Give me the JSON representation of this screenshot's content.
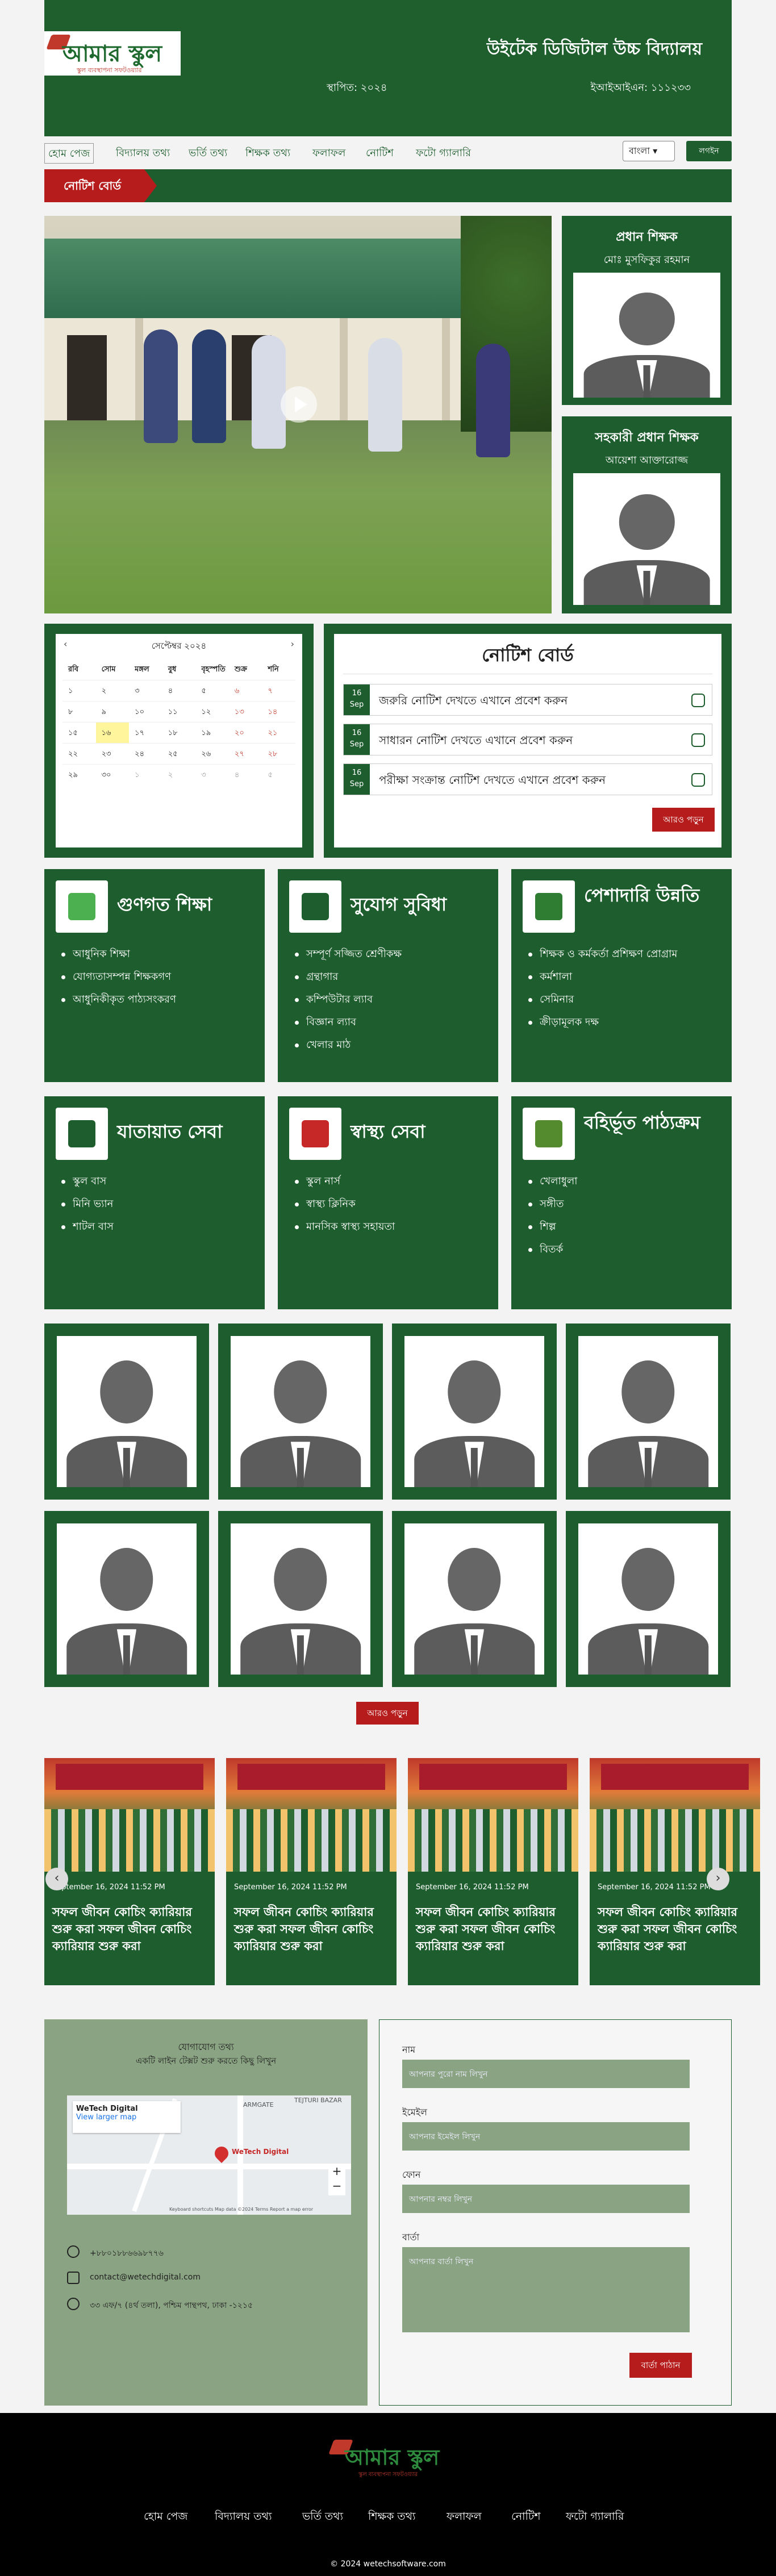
{
  "header": {
    "logo_text": "আমার স্কুল",
    "logo_sub": "স্কুল ব্যবস্থাপনা সফটওয়্যার",
    "school_name": "উইটেক ডিজিটাল উচ্চ বিদ্যালয়",
    "established": "স্থাপিত: ২০২৪",
    "eiin": "ইআইআইএন: ১১১২৩৩"
  },
  "nav": {
    "items": [
      "হোম পেজ",
      "বিদ্যালয় তথ্য",
      "ভর্তি তথ্য",
      "শিক্ষক তথ্য",
      "ফলাফল",
      "নোটিশ",
      "ফটো গ্যালারি"
    ],
    "language": "বাংলা",
    "login": "লগইন"
  },
  "notice_tag": "নোটিশ বোর্ড",
  "principal": {
    "title": "প্রধান শিক্ষক",
    "name": "মোঃ মুসফিকুর রহমান"
  },
  "assistant": {
    "title": "সহকারী প্রধান শিক্ষক",
    "name": "আয়েশা আক্তারোজ্জ"
  },
  "calendar": {
    "title": "সেপ্টেম্বর ২০২৪",
    "prev": "‹",
    "next": "›",
    "days": [
      "রবি",
      "সোম",
      "মঙ্গল",
      "বুধ",
      "বৃহস্পতি",
      "শুক্র",
      "শনি"
    ],
    "weeks": [
      [
        "১",
        "২",
        "৩",
        "৪",
        "৫",
        "৬",
        "৭"
      ],
      [
        "৮",
        "৯",
        "১০",
        "১১",
        "১২",
        "১৩",
        "১৪"
      ],
      [
        "১৫",
        "১৬",
        "১৭",
        "১৮",
        "১৯",
        "২০",
        "২১"
      ],
      [
        "২২",
        "২৩",
        "২৪",
        "২৫",
        "২৬",
        "২৭",
        "২৮"
      ],
      [
        "২৯",
        "৩০",
        "১",
        "২",
        "৩",
        "৪",
        "৫"
      ]
    ],
    "today": "১৬",
    "weekend_color": "#c0392b",
    "today_color": "#fff59d"
  },
  "notice_board": {
    "title": "নোটিশ বোর্ড",
    "items": [
      {
        "day": "16",
        "month": "Sep",
        "text": "জরুরি নোটিশ দেখতে এখানে প্রবেশ করুন"
      },
      {
        "day": "16",
        "month": "Sep",
        "text": "সাধারন নোটিশ দেখতে এখানে প্রবেশ করুন"
      },
      {
        "day": "16",
        "month": "Sep",
        "text": "পরীক্ষা সংক্রান্ত নোটিশ দেখতে এখানে প্রবেশ করুন"
      }
    ],
    "more": "আরও পড়ুন"
  },
  "features": [
    {
      "title": "গুণগত শিক্ষা",
      "icon": "book-icon",
      "items": [
        "আধুনিক শিক্ষা",
        "যোগ্যতাসম্পন্ন শিক্ষকগণ",
        "আধুনিকীকৃত পাঠ্যসংকরণ"
      ]
    },
    {
      "title": "সুযোগ সুবিধা",
      "icon": "school-building-icon",
      "items": [
        "সম্পূর্ণ সজ্জিত শ্রেণীকক্ষ",
        "গ্রন্থাগার",
        "কম্পিউটার ল্যাব",
        "বিজ্ঞান ল্যাব",
        "খেলার মাঠ"
      ]
    },
    {
      "title": "পেশাদারি উন্নতি",
      "icon": "professional-icon",
      "items": [
        "শিক্ষক ও কর্মকর্তা প্রশিক্ষণ প্রোগ্রাম",
        "কর্মশালা",
        "সেমিনার",
        "ক্রীড়ামূলক দক্ষ"
      ]
    },
    {
      "title": "যাতায়াত সেবা",
      "icon": "bus-icon",
      "items": [
        "স্কুল বাস",
        "মিনি ভ্যান",
        "শাটল বাস"
      ]
    },
    {
      "title": "স্বাস্থ্য সেবা",
      "icon": "health-icon",
      "items": [
        "স্কুল নার্স",
        "স্বাস্থ্য ক্লিনিক",
        "মানসিক স্বাস্থ্য সহায়তা"
      ]
    },
    {
      "title": "বহির্ভূত পাঠ্যক্রম",
      "icon": "activity-icon",
      "items": [
        "খেলাধুলা",
        "সঙ্গীত",
        "শিল্প",
        "বিতর্ক"
      ]
    }
  ],
  "teachers_more": "আরও পড়ুন",
  "news": [
    {
      "date": "September 16, 2024 11:52 PM",
      "title": "সফল জীবন কোচিং ক্যারিয়ার শুরু করা সফল জীবন কোচিং ক্যারিয়ার শুরু করা"
    },
    {
      "date": "September 16, 2024 11:52 PM",
      "title": "সফল জীবন কোচিং ক্যারিয়ার শুরু করা সফল জীবন কোচিং ক্যারিয়ার শুরু করা"
    },
    {
      "date": "September 16, 2024 11:52 PM",
      "title": "সফল জীবন কোচিং ক্যারিয়ার শুরু করা সফল জীবন কোচিং ক্যারিয়ার শুরু করা"
    },
    {
      "date": "September 16, 2024 11:52 PM",
      "title": "সফল জীবন কোচিং ক্যারিয়ার শুরু করা সফল জীবন কোচিং ক্যারিয়ার শুরু করা"
    }
  ],
  "contact": {
    "title": "যোগাযোগ তথ্য",
    "subtitle": "একটি লাইন টেক্সট শুরু করতে কিছু লিখুন",
    "map_place": "WeTech Digital",
    "map_link": "View larger map",
    "map_label1": "ARMGATE",
    "map_label2": "TEJTURI BAZAR",
    "map_pin_label": "WeTech Digital",
    "map_footer": "Keyboard shortcuts  Map data ©2024  Terms  Report a map error",
    "phone": "+৮৮০১৮৮৬৬৯৮৭৭৬",
    "email": "contact@wetechdigital.com",
    "address": "৩৩ এফ/৭ (৪র্থ তলা), পশ্চিম পান্থপথ, ঢাকা -১২১৫"
  },
  "form": {
    "name_label": "নাম",
    "name_ph": "আপনার পুরো নাম লিখুন",
    "email_label": "ইমেইল",
    "email_ph": "আপনার ইমেইল লিখুন",
    "phone_label": "ফোন",
    "phone_ph": "আপনার নম্বর লিখুন",
    "msg_label": "বার্তা",
    "msg_ph": "আপনার বার্তা লিখুন",
    "submit": "বার্তা পাঠান"
  },
  "footer": {
    "logo_text": "আমার স্কুল",
    "logo_sub": "স্কুল ব্যবস্থাপনা সফটওয়্যার",
    "links": [
      "হোম পেজ",
      "বিদ্যালয় তথ্য",
      "ভর্তি তথ্য",
      "শিক্ষক তথ্য",
      "ফলাফল",
      "নোটিশ",
      "ফটো গ্যালারি"
    ],
    "copyright": "© 2024 wetechsoftware.com"
  },
  "colors": {
    "primary": "#1e5e2e",
    "accent": "#b71c1c",
    "form_input": "#8aa382"
  }
}
